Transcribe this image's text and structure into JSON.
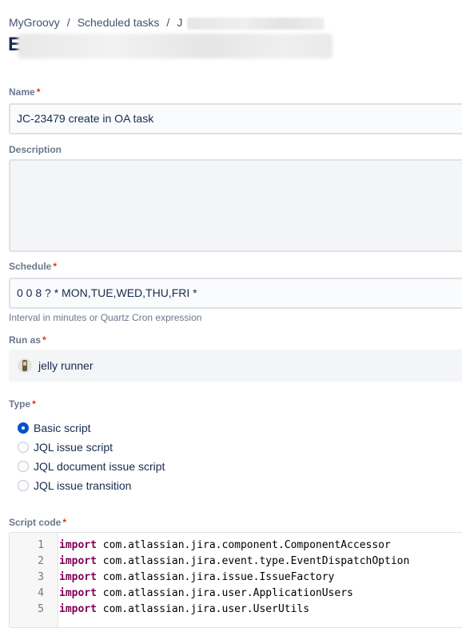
{
  "breadcrumb": {
    "items": [
      "MyGroovy",
      "Scheduled tasks",
      "J"
    ]
  },
  "page": {
    "title_visible": "E"
  },
  "form": {
    "name": {
      "label": "Name",
      "value": "JC-23479 create in OA task"
    },
    "description": {
      "label": "Description",
      "value": ""
    },
    "schedule": {
      "label": "Schedule",
      "value": "0 0 8 ? * MON,TUE,WED,THU,FRI *",
      "help": "Interval in minutes or Quartz Cron expression"
    },
    "run_as": {
      "label": "Run as",
      "user": "jelly runner"
    },
    "type": {
      "label": "Type",
      "options": [
        "Basic script",
        "JQL issue script",
        "JQL document issue script",
        "JQL issue transition"
      ],
      "selected": "Basic script"
    },
    "script_code": {
      "label": "Script code",
      "lines": [
        {
          "num": "1",
          "kw": "import",
          "rest": " com.atlassian.jira.component.ComponentAccessor"
        },
        {
          "num": "2",
          "kw": "import",
          "rest": " com.atlassian.jira.event.type.EventDispatchOption"
        },
        {
          "num": "3",
          "kw": "import",
          "rest": " com.atlassian.jira.issue.IssueFactory"
        },
        {
          "num": "4",
          "kw": "import",
          "rest": " com.atlassian.jira.user.ApplicationUsers"
        },
        {
          "num": "5",
          "kw": "import",
          "rest": " com.atlassian.jira.user.UserUtils"
        }
      ]
    },
    "required_marker": "*"
  },
  "colors": {
    "accent": "#0052cc",
    "required": "#de350b",
    "keyword": "#7f0055"
  }
}
